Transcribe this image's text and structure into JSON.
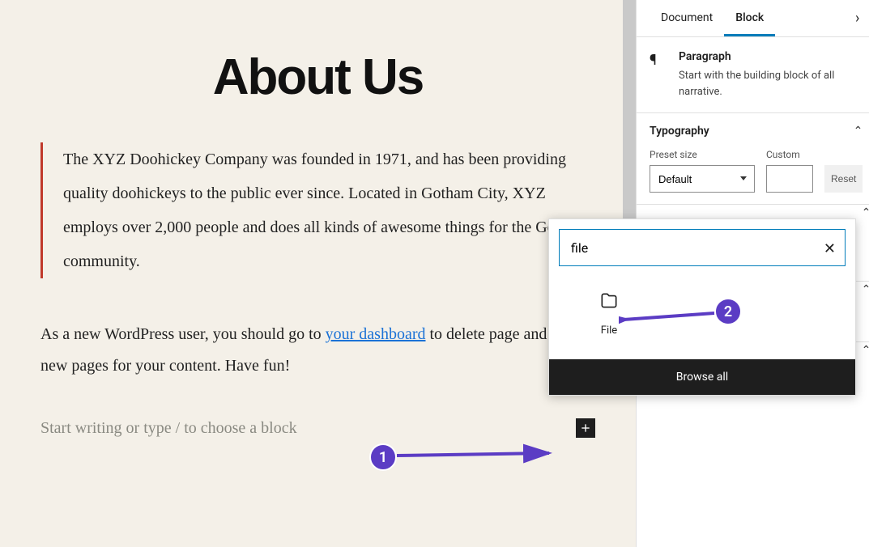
{
  "editor": {
    "page_title": "About Us",
    "quote": "The XYZ Doohickey Company was founded in 1971, and has been providing quality doohickeys to the public ever since. Located in Gotham City, XYZ employs over 2,000 people and does all kinds of awesome things for the Gotham community.",
    "body_before_link": "As a new WordPress user, you should go to ",
    "link_text": "your dashboard",
    "body_after_link": " to delete page and create new pages for your content. Have fun!",
    "placeholder": "Start writing or type / to choose a block"
  },
  "sidebar": {
    "tabs": {
      "document": "Document",
      "block": "Block"
    },
    "block_info": {
      "title": "Paragraph",
      "description": "Start with the building block of all narrative.",
      "icon_name": "paragraph-icon"
    },
    "typography": {
      "section_title": "Typography",
      "preset_label": "Preset size",
      "preset_value": "Default",
      "custom_label": "Custom",
      "custom_value": "",
      "reset_label": "Reset"
    }
  },
  "inserter": {
    "search_value": "file",
    "result": {
      "label": "File",
      "icon_name": "file-icon"
    },
    "browse_all": "Browse all"
  },
  "annotations": {
    "badge1": "1",
    "badge2": "2"
  }
}
